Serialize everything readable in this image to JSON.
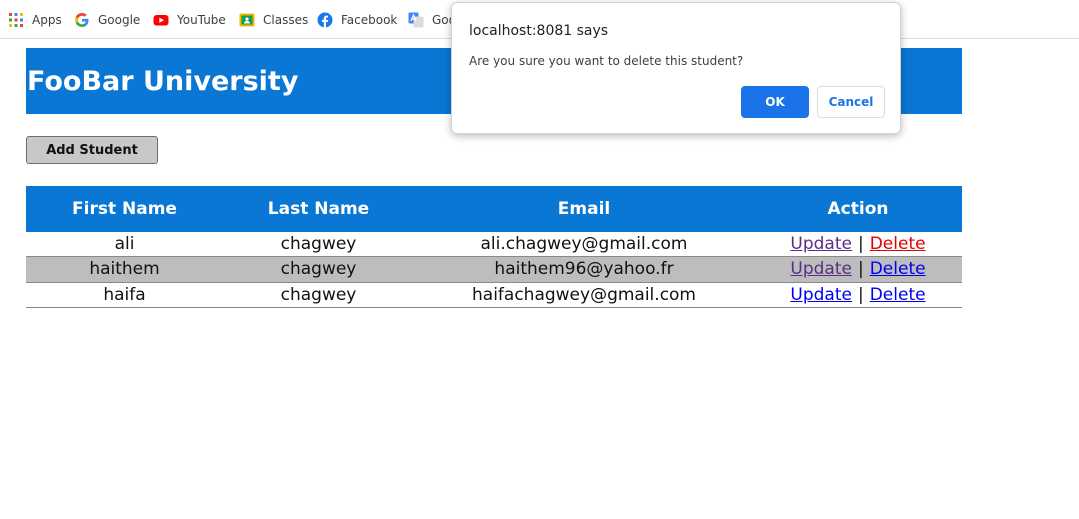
{
  "bookmarks": [
    {
      "label": "Apps",
      "icon": "apps-grid-icon"
    },
    {
      "label": "Google",
      "icon": "google-icon"
    },
    {
      "label": "YouTube",
      "icon": "youtube-icon"
    },
    {
      "label": "Classes",
      "icon": "classes-icon"
    },
    {
      "label": "Facebook",
      "icon": "facebook-icon"
    },
    {
      "label": "Goo",
      "icon": "google-translate-icon"
    }
  ],
  "header": {
    "title": "FooBar University",
    "color": "#0a77d5"
  },
  "actions": {
    "add_student": "Add Student"
  },
  "table": {
    "columns": [
      "First Name",
      "Last Name",
      "Email",
      "Action"
    ],
    "rows": [
      {
        "first": "ali",
        "last": "chagwey",
        "email": "ali.chagwey@gmail.com",
        "update": "Update",
        "separator": "|",
        "delete": "Delete"
      },
      {
        "first": "haithem",
        "last": "chagwey",
        "email": "haithem96@yahoo.fr",
        "update": "Update",
        "separator": "|",
        "delete": "Delete"
      },
      {
        "first": "haifa",
        "last": "chagwey",
        "email": "haifachagwey@gmail.com",
        "update": "Update",
        "separator": "|",
        "delete": "Delete"
      }
    ]
  },
  "dialog": {
    "title": "localhost:8081 says",
    "message": "Are you sure you want to delete this student?",
    "ok_label": "OK",
    "cancel_label": "Cancel",
    "accent": "#1a73e8"
  }
}
